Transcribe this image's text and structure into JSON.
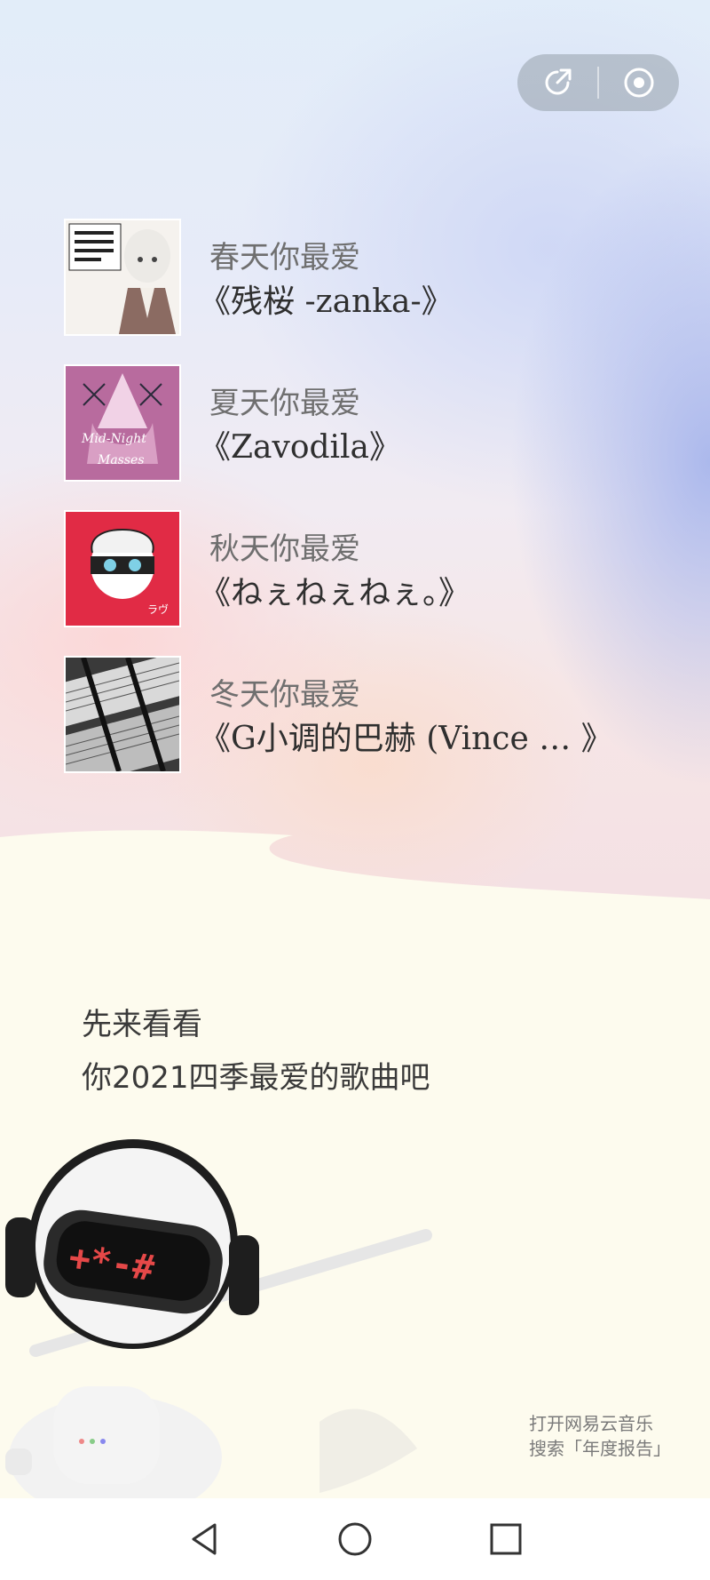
{
  "header": {
    "share_icon": "share-arrow-icon",
    "close_icon": "target-circle-icon"
  },
  "songs": [
    {
      "season": "春天你最爱",
      "title": "《残桜 -zanka-》",
      "cover_colors": [
        "#f4f0ec",
        "#8a6f68"
      ]
    },
    {
      "season": "夏天你最爱",
      "title": "《Zavodila》",
      "cover_colors": [
        "#c17aa7",
        "#f1d6e8"
      ]
    },
    {
      "season": "秋天你最爱",
      "title": "《ねぇねぇねぇ。》",
      "cover_colors": [
        "#e12b45",
        "#ffffff"
      ]
    },
    {
      "season": "冬天你最爱",
      "title": "《G小调的巴赫 (Vince … 》",
      "cover_colors": [
        "#2a2a2a",
        "#d8d8d8"
      ]
    }
  ],
  "intro": {
    "line1": "先来看看",
    "line2": "你2021四季最爱的歌曲吧"
  },
  "hint": {
    "line1": "打开网易云音乐",
    "line2": "搜索「年度报告」"
  },
  "navbar": {
    "back_icon": "back-triangle-icon",
    "home_icon": "home-circle-icon",
    "recents_icon": "recents-square-icon"
  },
  "colors": {
    "accent_red": "#e12b45",
    "cream": "#fdfbee",
    "text_dark": "#2f2f2f"
  }
}
